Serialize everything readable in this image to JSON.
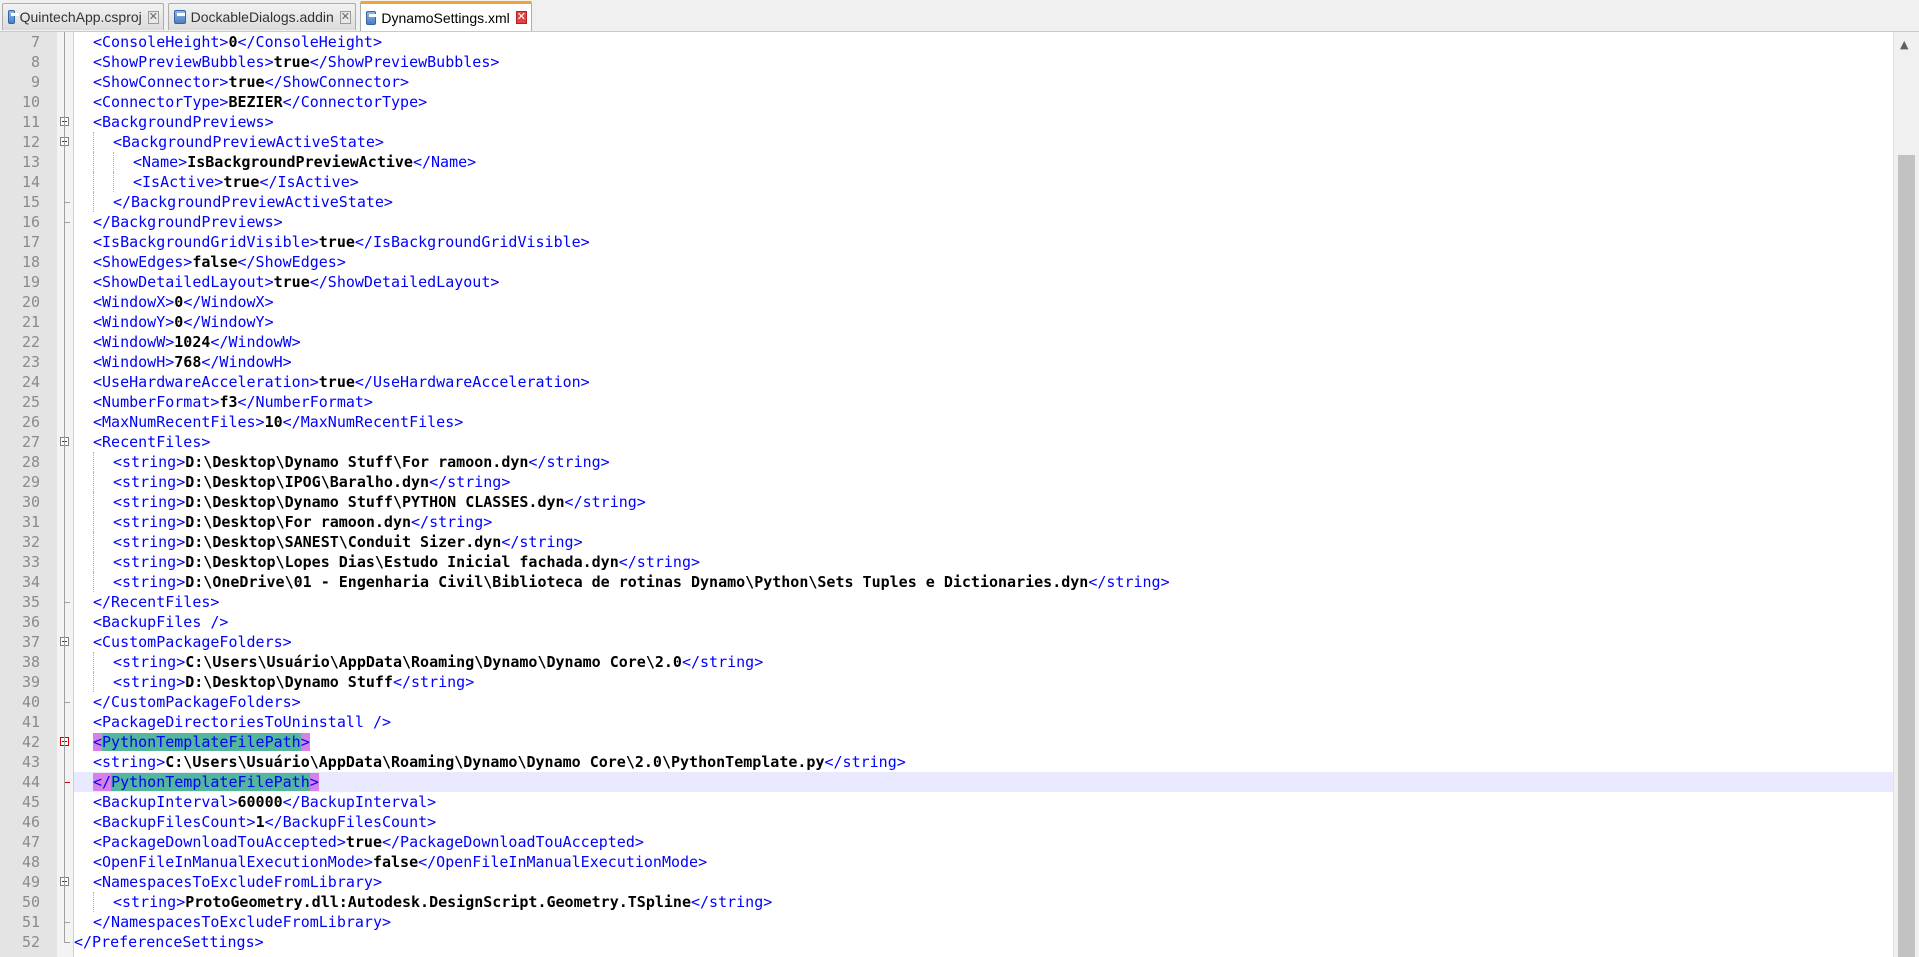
{
  "tabs": [
    {
      "label": "QuintechApp.csproj",
      "active": false
    },
    {
      "label": "DockableDialogs.addin",
      "active": false
    },
    {
      "label": "DynamoSettings.xml",
      "active": true
    }
  ],
  "lines": [
    {
      "n": "7",
      "indent": 1,
      "parts": [
        [
          "t",
          "<ConsoleHeight>"
        ],
        [
          "v",
          "0"
        ],
        [
          "t",
          "</ConsoleHeight>"
        ]
      ]
    },
    {
      "n": "8",
      "indent": 1,
      "parts": [
        [
          "t",
          "<ShowPreviewBubbles>"
        ],
        [
          "v",
          "true"
        ],
        [
          "t",
          "</ShowPreviewBubbles>"
        ]
      ]
    },
    {
      "n": "9",
      "indent": 1,
      "parts": [
        [
          "t",
          "<ShowConnector>"
        ],
        [
          "v",
          "true"
        ],
        [
          "t",
          "</ShowConnector>"
        ]
      ]
    },
    {
      "n": "10",
      "indent": 1,
      "parts": [
        [
          "t",
          "<ConnectorType>"
        ],
        [
          "v",
          "BEZIER"
        ],
        [
          "t",
          "</ConnectorType>"
        ]
      ]
    },
    {
      "n": "11",
      "indent": 1,
      "parts": [
        [
          "t",
          "<BackgroundPreviews>"
        ]
      ]
    },
    {
      "n": "12",
      "indent": 2,
      "parts": [
        [
          "t",
          "<BackgroundPreviewActiveState>"
        ]
      ]
    },
    {
      "n": "13",
      "indent": 3,
      "parts": [
        [
          "t",
          "<Name>"
        ],
        [
          "v",
          "IsBackgroundPreviewActive"
        ],
        [
          "t",
          "</Name>"
        ]
      ]
    },
    {
      "n": "14",
      "indent": 3,
      "parts": [
        [
          "t",
          "<IsActive>"
        ],
        [
          "v",
          "true"
        ],
        [
          "t",
          "</IsActive>"
        ]
      ]
    },
    {
      "n": "15",
      "indent": 2,
      "parts": [
        [
          "t",
          "</BackgroundPreviewActiveState>"
        ]
      ]
    },
    {
      "n": "16",
      "indent": 1,
      "parts": [
        [
          "t",
          "</BackgroundPreviews>"
        ]
      ]
    },
    {
      "n": "17",
      "indent": 1,
      "parts": [
        [
          "t",
          "<IsBackgroundGridVisible>"
        ],
        [
          "v",
          "true"
        ],
        [
          "t",
          "</IsBackgroundGridVisible>"
        ]
      ]
    },
    {
      "n": "18",
      "indent": 1,
      "parts": [
        [
          "t",
          "<ShowEdges>"
        ],
        [
          "v",
          "false"
        ],
        [
          "t",
          "</ShowEdges>"
        ]
      ]
    },
    {
      "n": "19",
      "indent": 1,
      "parts": [
        [
          "t",
          "<ShowDetailedLayout>"
        ],
        [
          "v",
          "true"
        ],
        [
          "t",
          "</ShowDetailedLayout>"
        ]
      ]
    },
    {
      "n": "20",
      "indent": 1,
      "parts": [
        [
          "t",
          "<WindowX>"
        ],
        [
          "v",
          "0"
        ],
        [
          "t",
          "</WindowX>"
        ]
      ]
    },
    {
      "n": "21",
      "indent": 1,
      "parts": [
        [
          "t",
          "<WindowY>"
        ],
        [
          "v",
          "0"
        ],
        [
          "t",
          "</WindowY>"
        ]
      ]
    },
    {
      "n": "22",
      "indent": 1,
      "parts": [
        [
          "t",
          "<WindowW>"
        ],
        [
          "v",
          "1024"
        ],
        [
          "t",
          "</WindowW>"
        ]
      ]
    },
    {
      "n": "23",
      "indent": 1,
      "parts": [
        [
          "t",
          "<WindowH>"
        ],
        [
          "v",
          "768"
        ],
        [
          "t",
          "</WindowH>"
        ]
      ]
    },
    {
      "n": "24",
      "indent": 1,
      "parts": [
        [
          "t",
          "<UseHardwareAcceleration>"
        ],
        [
          "v",
          "true"
        ],
        [
          "t",
          "</UseHardwareAcceleration>"
        ]
      ]
    },
    {
      "n": "25",
      "indent": 1,
      "parts": [
        [
          "t",
          "<NumberFormat>"
        ],
        [
          "v",
          "f3"
        ],
        [
          "t",
          "</NumberFormat>"
        ]
      ]
    },
    {
      "n": "26",
      "indent": 1,
      "parts": [
        [
          "t",
          "<MaxNumRecentFiles>"
        ],
        [
          "v",
          "10"
        ],
        [
          "t",
          "</MaxNumRecentFiles>"
        ]
      ]
    },
    {
      "n": "27",
      "indent": 1,
      "parts": [
        [
          "t",
          "<RecentFiles>"
        ]
      ]
    },
    {
      "n": "28",
      "indent": 2,
      "parts": [
        [
          "t",
          "<string>"
        ],
        [
          "v",
          "D:\\Desktop\\Dynamo Stuff\\For ramoon.dyn"
        ],
        [
          "t",
          "</string>"
        ]
      ]
    },
    {
      "n": "29",
      "indent": 2,
      "parts": [
        [
          "t",
          "<string>"
        ],
        [
          "v",
          "D:\\Desktop\\IPOG\\Baralho.dyn"
        ],
        [
          "t",
          "</string>"
        ]
      ]
    },
    {
      "n": "30",
      "indent": 2,
      "parts": [
        [
          "t",
          "<string>"
        ],
        [
          "v",
          "D:\\Desktop\\Dynamo Stuff\\PYTHON CLASSES.dyn"
        ],
        [
          "t",
          "</string>"
        ]
      ]
    },
    {
      "n": "31",
      "indent": 2,
      "parts": [
        [
          "t",
          "<string>"
        ],
        [
          "v",
          "D:\\Desktop\\For ramoon.dyn"
        ],
        [
          "t",
          "</string>"
        ]
      ]
    },
    {
      "n": "32",
      "indent": 2,
      "parts": [
        [
          "t",
          "<string>"
        ],
        [
          "v",
          "D:\\Desktop\\SANEST\\Conduit Sizer.dyn"
        ],
        [
          "t",
          "</string>"
        ]
      ]
    },
    {
      "n": "33",
      "indent": 2,
      "parts": [
        [
          "t",
          "<string>"
        ],
        [
          "v",
          "D:\\Desktop\\Lopes Dias\\Estudo Inicial fachada.dyn"
        ],
        [
          "t",
          "</string>"
        ]
      ]
    },
    {
      "n": "34",
      "indent": 2,
      "parts": [
        [
          "t",
          "<string>"
        ],
        [
          "v",
          "D:\\OneDrive\\01 - Engenharia Civil\\Biblioteca de rotinas Dynamo\\Python\\Sets Tuples e Dictionaries.dyn"
        ],
        [
          "t",
          "</string>"
        ]
      ]
    },
    {
      "n": "35",
      "indent": 1,
      "parts": [
        [
          "t",
          "</RecentFiles>"
        ]
      ]
    },
    {
      "n": "36",
      "indent": 1,
      "parts": [
        [
          "t",
          "<BackupFiles />"
        ]
      ]
    },
    {
      "n": "37",
      "indent": 1,
      "parts": [
        [
          "t",
          "<CustomPackageFolders>"
        ]
      ]
    },
    {
      "n": "38",
      "indent": 2,
      "parts": [
        [
          "t",
          "<string>"
        ],
        [
          "v",
          "C:\\Users\\Usuário\\AppData\\Roaming\\Dynamo\\Dynamo Core\\2.0"
        ],
        [
          "t",
          "</string>"
        ]
      ]
    },
    {
      "n": "39",
      "indent": 2,
      "parts": [
        [
          "t",
          "<string>"
        ],
        [
          "v",
          "D:\\Desktop\\Dynamo Stuff"
        ],
        [
          "t",
          "</string>"
        ]
      ]
    },
    {
      "n": "40",
      "indent": 1,
      "parts": [
        [
          "t",
          "</CustomPackageFolders>"
        ]
      ]
    },
    {
      "n": "41",
      "indent": 1,
      "parts": [
        [
          "t",
          "<PackageDirectoriesToUninstall />"
        ]
      ]
    },
    {
      "n": "42",
      "indent": 1,
      "parts": [
        [
          "b",
          "<"
        ],
        [
          "h",
          "PythonTemplateFilePath"
        ],
        [
          "b",
          ">"
        ]
      ]
    },
    {
      "n": "43",
      "indent": 1,
      "parts": [
        [
          "t",
          "<string>"
        ],
        [
          "v",
          "C:\\Users\\Usuário\\AppData\\Roaming\\Dynamo\\Dynamo Core\\2.0\\PythonTemplate.py"
        ],
        [
          "t",
          "</string>"
        ]
      ]
    },
    {
      "n": "44",
      "indent": 1,
      "current": true,
      "parts": [
        [
          "b",
          "</"
        ],
        [
          "h",
          "PythonTemplateFilePath"
        ],
        [
          "b",
          ">"
        ]
      ]
    },
    {
      "n": "45",
      "indent": 1,
      "parts": [
        [
          "t",
          "<BackupInterval>"
        ],
        [
          "v",
          "60000"
        ],
        [
          "t",
          "</BackupInterval>"
        ]
      ]
    },
    {
      "n": "46",
      "indent": 1,
      "parts": [
        [
          "t",
          "<BackupFilesCount>"
        ],
        [
          "v",
          "1"
        ],
        [
          "t",
          "</BackupFilesCount>"
        ]
      ]
    },
    {
      "n": "47",
      "indent": 1,
      "parts": [
        [
          "t",
          "<PackageDownloadTouAccepted>"
        ],
        [
          "v",
          "true"
        ],
        [
          "t",
          "</PackageDownloadTouAccepted>"
        ]
      ]
    },
    {
      "n": "48",
      "indent": 1,
      "parts": [
        [
          "t",
          "<OpenFileInManualExecutionMode>"
        ],
        [
          "v",
          "false"
        ],
        [
          "t",
          "</OpenFileInManualExecutionMode>"
        ]
      ]
    },
    {
      "n": "49",
      "indent": 1,
      "parts": [
        [
          "t",
          "<NamespacesToExcludeFromLibrary>"
        ]
      ]
    },
    {
      "n": "50",
      "indent": 2,
      "parts": [
        [
          "t",
          "<string>"
        ],
        [
          "v",
          "ProtoGeometry.dll:Autodesk.DesignScript.Geometry.TSpline"
        ],
        [
          "t",
          "</string>"
        ]
      ]
    },
    {
      "n": "51",
      "indent": 1,
      "parts": [
        [
          "t",
          "</NamespacesToExcludeFromLibrary>"
        ]
      ]
    },
    {
      "n": "52",
      "indent": 0,
      "parts": [
        [
          "t",
          "</PreferenceSettings>"
        ]
      ]
    }
  ],
  "folds": [
    {
      "line": "11",
      "end": "16"
    },
    {
      "line": "12",
      "end": "15"
    },
    {
      "line": "27",
      "end": "35"
    },
    {
      "line": "37",
      "end": "40"
    },
    {
      "line": "42",
      "end": "44",
      "red": true
    },
    {
      "line": "49",
      "end": "51"
    }
  ],
  "colors": {
    "tag": "#0000ff",
    "value": "#000000",
    "current_line": "#e8e8ff",
    "brace_match": "#d780e8",
    "word_highlight": "#54b69d",
    "active_tab_accent": "#f4a13a"
  },
  "icons": {
    "file": "xml-file-icon",
    "close": "close-tab-icon",
    "scroll_up": "scroll-up-arrow-icon"
  }
}
